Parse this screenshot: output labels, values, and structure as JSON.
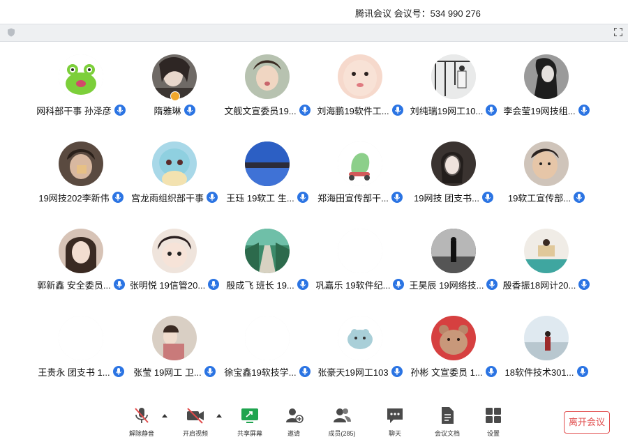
{
  "window": {
    "title": "腾讯会议  会议号：534 990 276"
  },
  "accent_color": "#2b74e3",
  "leave_color": "#e14b4b",
  "participants": [
    {
      "name": "网科部干事 孙泽彦",
      "mic": "on"
    },
    {
      "name": "隋雅琳",
      "mic": "on",
      "badge": "host"
    },
    {
      "name": "文舰文宣委员19...",
      "mic": "on"
    },
    {
      "name": "刘海鹏19软件工...",
      "mic": "on"
    },
    {
      "name": "刘纯瑞19网工10...",
      "mic": "on"
    },
    {
      "name": "李会莹19网技组...",
      "mic": "on"
    },
    {
      "name": "19网技202李新伟",
      "mic": "on"
    },
    {
      "name": "宫龙雨组织部干事",
      "mic": "on"
    },
    {
      "name": "王珏 19软工 生...",
      "mic": "on"
    },
    {
      "name": "郑海田宣传部干...",
      "mic": "on"
    },
    {
      "name": "19网技  团支书...",
      "mic": "on"
    },
    {
      "name": "19软工宣传部...",
      "mic": "on"
    },
    {
      "name": "郭新鑫 安全委员...",
      "mic": "on"
    },
    {
      "name": "张明悦 19信管20...",
      "mic": "on"
    },
    {
      "name": "殷成飞 班长 19...",
      "mic": "on"
    },
    {
      "name": "巩嘉乐 19软件纪...",
      "mic": "on"
    },
    {
      "name": "王昊辰 19网络技...",
      "mic": "on"
    },
    {
      "name": "殷香振18网计20...",
      "mic": "on"
    },
    {
      "name": "王贵永 团支书 1...",
      "mic": "on"
    },
    {
      "name": "张莹 19网工 卫...",
      "mic": "on"
    },
    {
      "name": "徐宝鑫19软技学...",
      "mic": "on"
    },
    {
      "name": "张豪天19网工103",
      "mic": "on"
    },
    {
      "name": "孙彬 文宣委员 1...",
      "mic": "on"
    },
    {
      "name": "18软件技术301...",
      "mic": "on"
    }
  ],
  "toolbar": {
    "unmute": "解除静音",
    "start_video": "开启视频",
    "share_screen": "共享屏幕",
    "invite": "邀请",
    "members": "成员(285)",
    "chat": "聊天",
    "docs": "会议文档",
    "settings": "设置",
    "leave": "离开会议"
  },
  "icons": [
    "shield-icon",
    "fullscreen-icon",
    "mic-icon",
    "muted-mic-icon",
    "video-off-icon",
    "share-screen-icon",
    "invite-icon",
    "members-icon",
    "chat-icon",
    "docs-icon",
    "settings-icon",
    "caret-up-icon"
  ]
}
